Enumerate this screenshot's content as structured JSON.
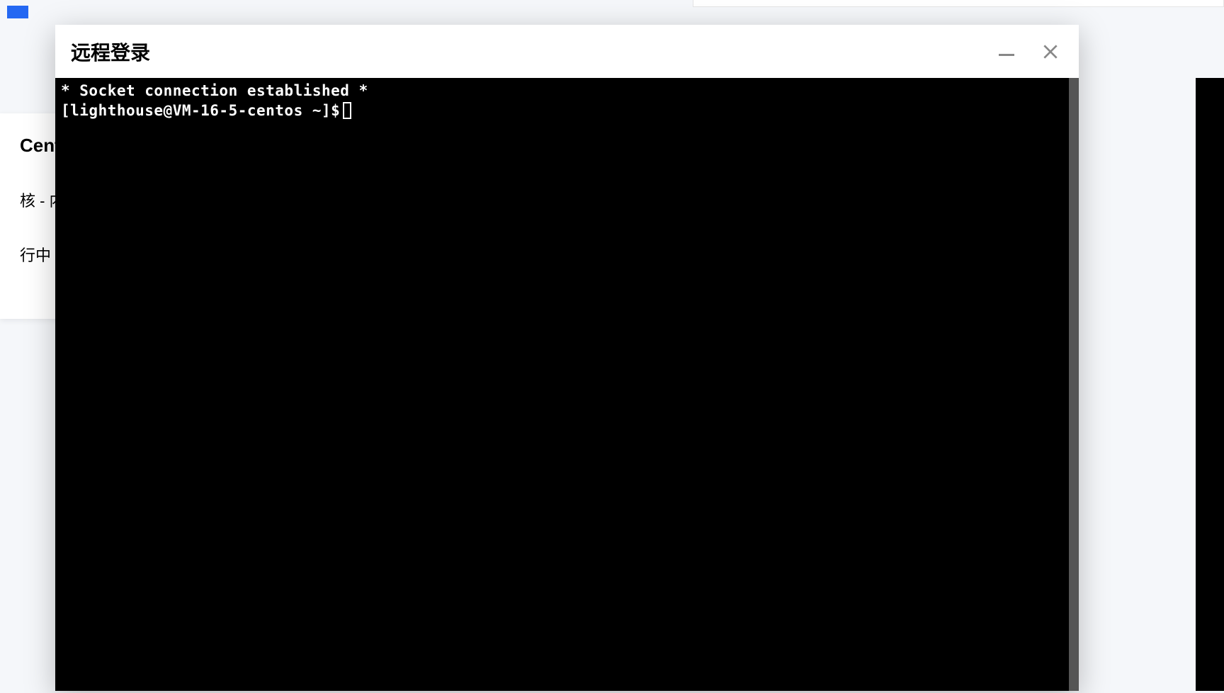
{
  "background": {
    "server_card": {
      "title_fragment": "Cent",
      "spec_fragment": "核 - 内",
      "status_fragment": "行中"
    }
  },
  "modal": {
    "title": "远程登录",
    "controls": {
      "minimize": "minimize",
      "close": "close"
    }
  },
  "terminal": {
    "lines": [
      "* Socket connection established *"
    ],
    "prompt": "[lighthouse@VM-16-5-centos ~]$ "
  }
}
